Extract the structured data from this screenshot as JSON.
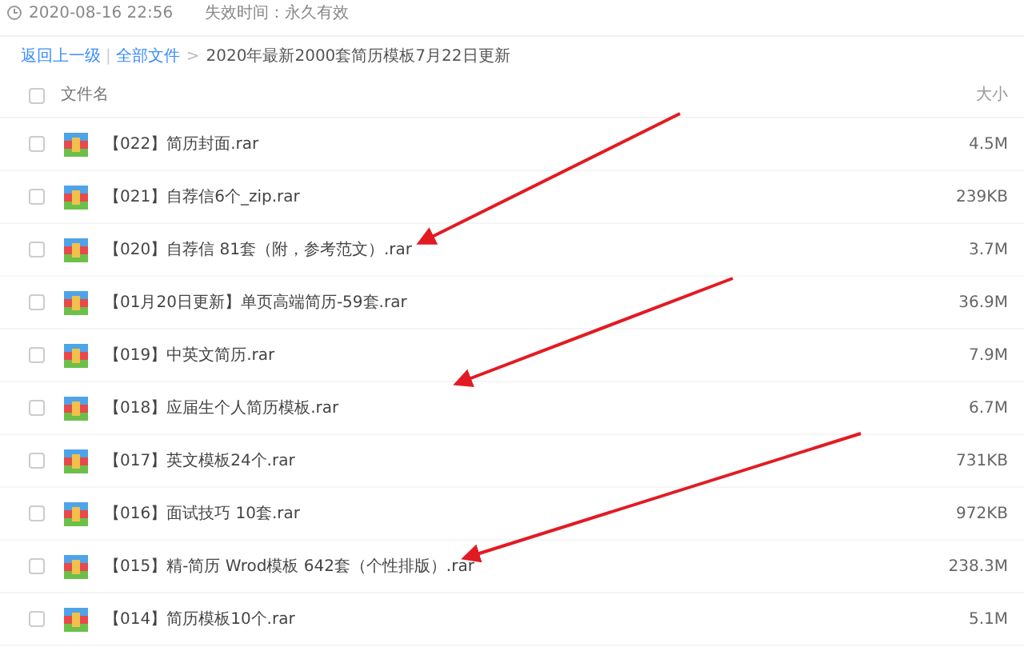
{
  "share_info": {
    "created": "2020-08-16 22:56",
    "expiry": "失效时间：永久有效"
  },
  "breadcrumb": {
    "back": "返回上一级",
    "all_files": "全部文件",
    "divider": "|",
    "separator": ">",
    "current": "2020年最新2000套简历模板7月22日更新"
  },
  "table": {
    "select_all_checked": false,
    "columns": [
      "文件名",
      "大小"
    ],
    "rows": [
      {
        "name": "【022】简历封面.rar",
        "size": "4.5M",
        "checked": false
      },
      {
        "name": "【021】自荐信6个_zip.rar",
        "size": "239KB",
        "checked": false
      },
      {
        "name": "【020】自荐信 81套（附，参考范文）.rar",
        "size": "3.7M",
        "checked": false
      },
      {
        "name": "【01月20日更新】单页高端简历-59套.rar",
        "size": "36.9M",
        "checked": false
      },
      {
        "name": "【019】中英文简历.rar",
        "size": "7.9M",
        "checked": false
      },
      {
        "name": "【018】应届生个人简历模板.rar",
        "size": "6.7M",
        "checked": false
      },
      {
        "name": "【017】英文模板24个.rar",
        "size": "731KB",
        "checked": false
      },
      {
        "name": "【016】面试技巧 10套.rar",
        "size": "972KB",
        "checked": false
      },
      {
        "name": "【015】精-简历 Wrod模板 642套（个性排版）.rar",
        "size": "238.3M",
        "checked": false
      },
      {
        "name": "【014】简历模板10个.rar",
        "size": "5.1M",
        "checked": false
      }
    ]
  }
}
